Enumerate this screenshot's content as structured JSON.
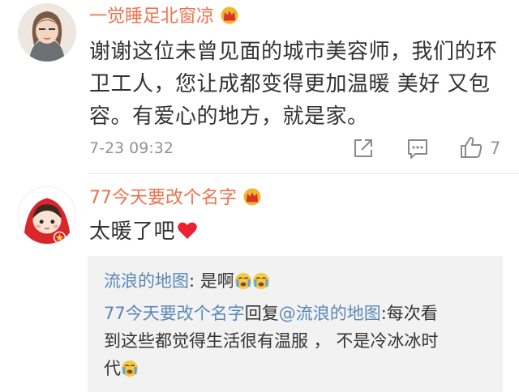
{
  "comments": [
    {
      "username": "一觉睡足北窗凉",
      "lines": [
        "谢谢这位未曾见面的城市美容师，我们的环",
        "卫工人，您让成都变得更加温暖 美好 又包",
        "容。有爱心的地方，就是家。"
      ],
      "timestamp": "7-23 09:32",
      "likes": "7"
    },
    {
      "username": "77今天要改个名字",
      "text": "太暖了吧"
    }
  ],
  "replies": {
    "reply1": {
      "user": "流浪的地图",
      "text": ": 是啊"
    },
    "reply2": {
      "user": "77今天要改个名字",
      "action": "回复",
      "mention": "@流浪的地图",
      "text_line1": ":每次看",
      "line2": "到这些都觉得生活很有温服 ， 不是冷冰冰时",
      "line3": "代"
    }
  },
  "colors": {
    "username": "#eb7350",
    "link": "#5b87b5",
    "meta": "#939393",
    "reply_bg": "#f2f2f2"
  }
}
